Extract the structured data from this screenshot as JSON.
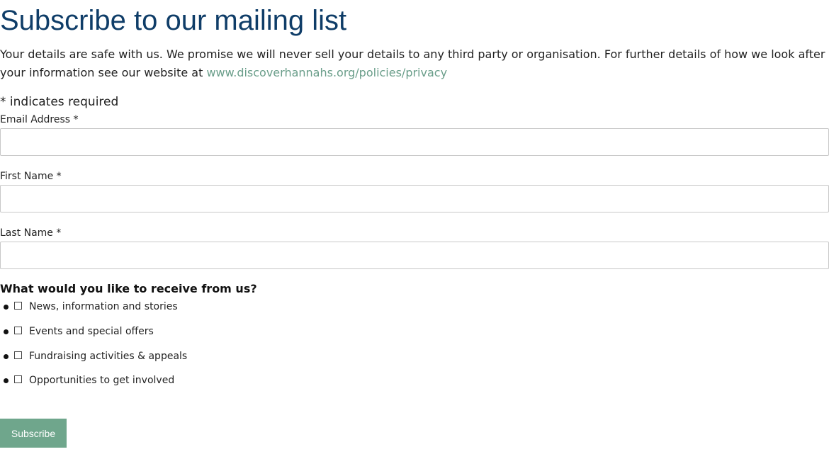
{
  "form": {
    "title": "Subscribe to our mailing list",
    "intro_text": "Your details are safe with us. We promise we will never sell your details to any third party or organisation. For further details of how we look after your information see our website at ",
    "privacy_link": "www.discoverhannahs.org/policies/privacy",
    "required_note": "* indicates required",
    "fields": [
      {
        "label": "Email Address *",
        "value": "",
        "placeholder": ""
      },
      {
        "label": "First Name *",
        "value": "",
        "placeholder": ""
      },
      {
        "label": "Last Name *",
        "value": "",
        "placeholder": ""
      }
    ],
    "interests_heading": "What would you like to receive from us?",
    "interests": [
      {
        "label": "News, information and stories",
        "checked": false
      },
      {
        "label": "Events and special offers",
        "checked": false
      },
      {
        "label": "Fundraising activities & appeals",
        "checked": false
      },
      {
        "label": "Opportunities to get involved",
        "checked": false
      }
    ],
    "submit_label": "Subscribe"
  },
  "colors": {
    "title": "#0f3d68",
    "link": "#6a9e8a",
    "button_bg": "#6fa68c",
    "button_text": "#ffffff",
    "input_border": "#c8c8c8"
  }
}
